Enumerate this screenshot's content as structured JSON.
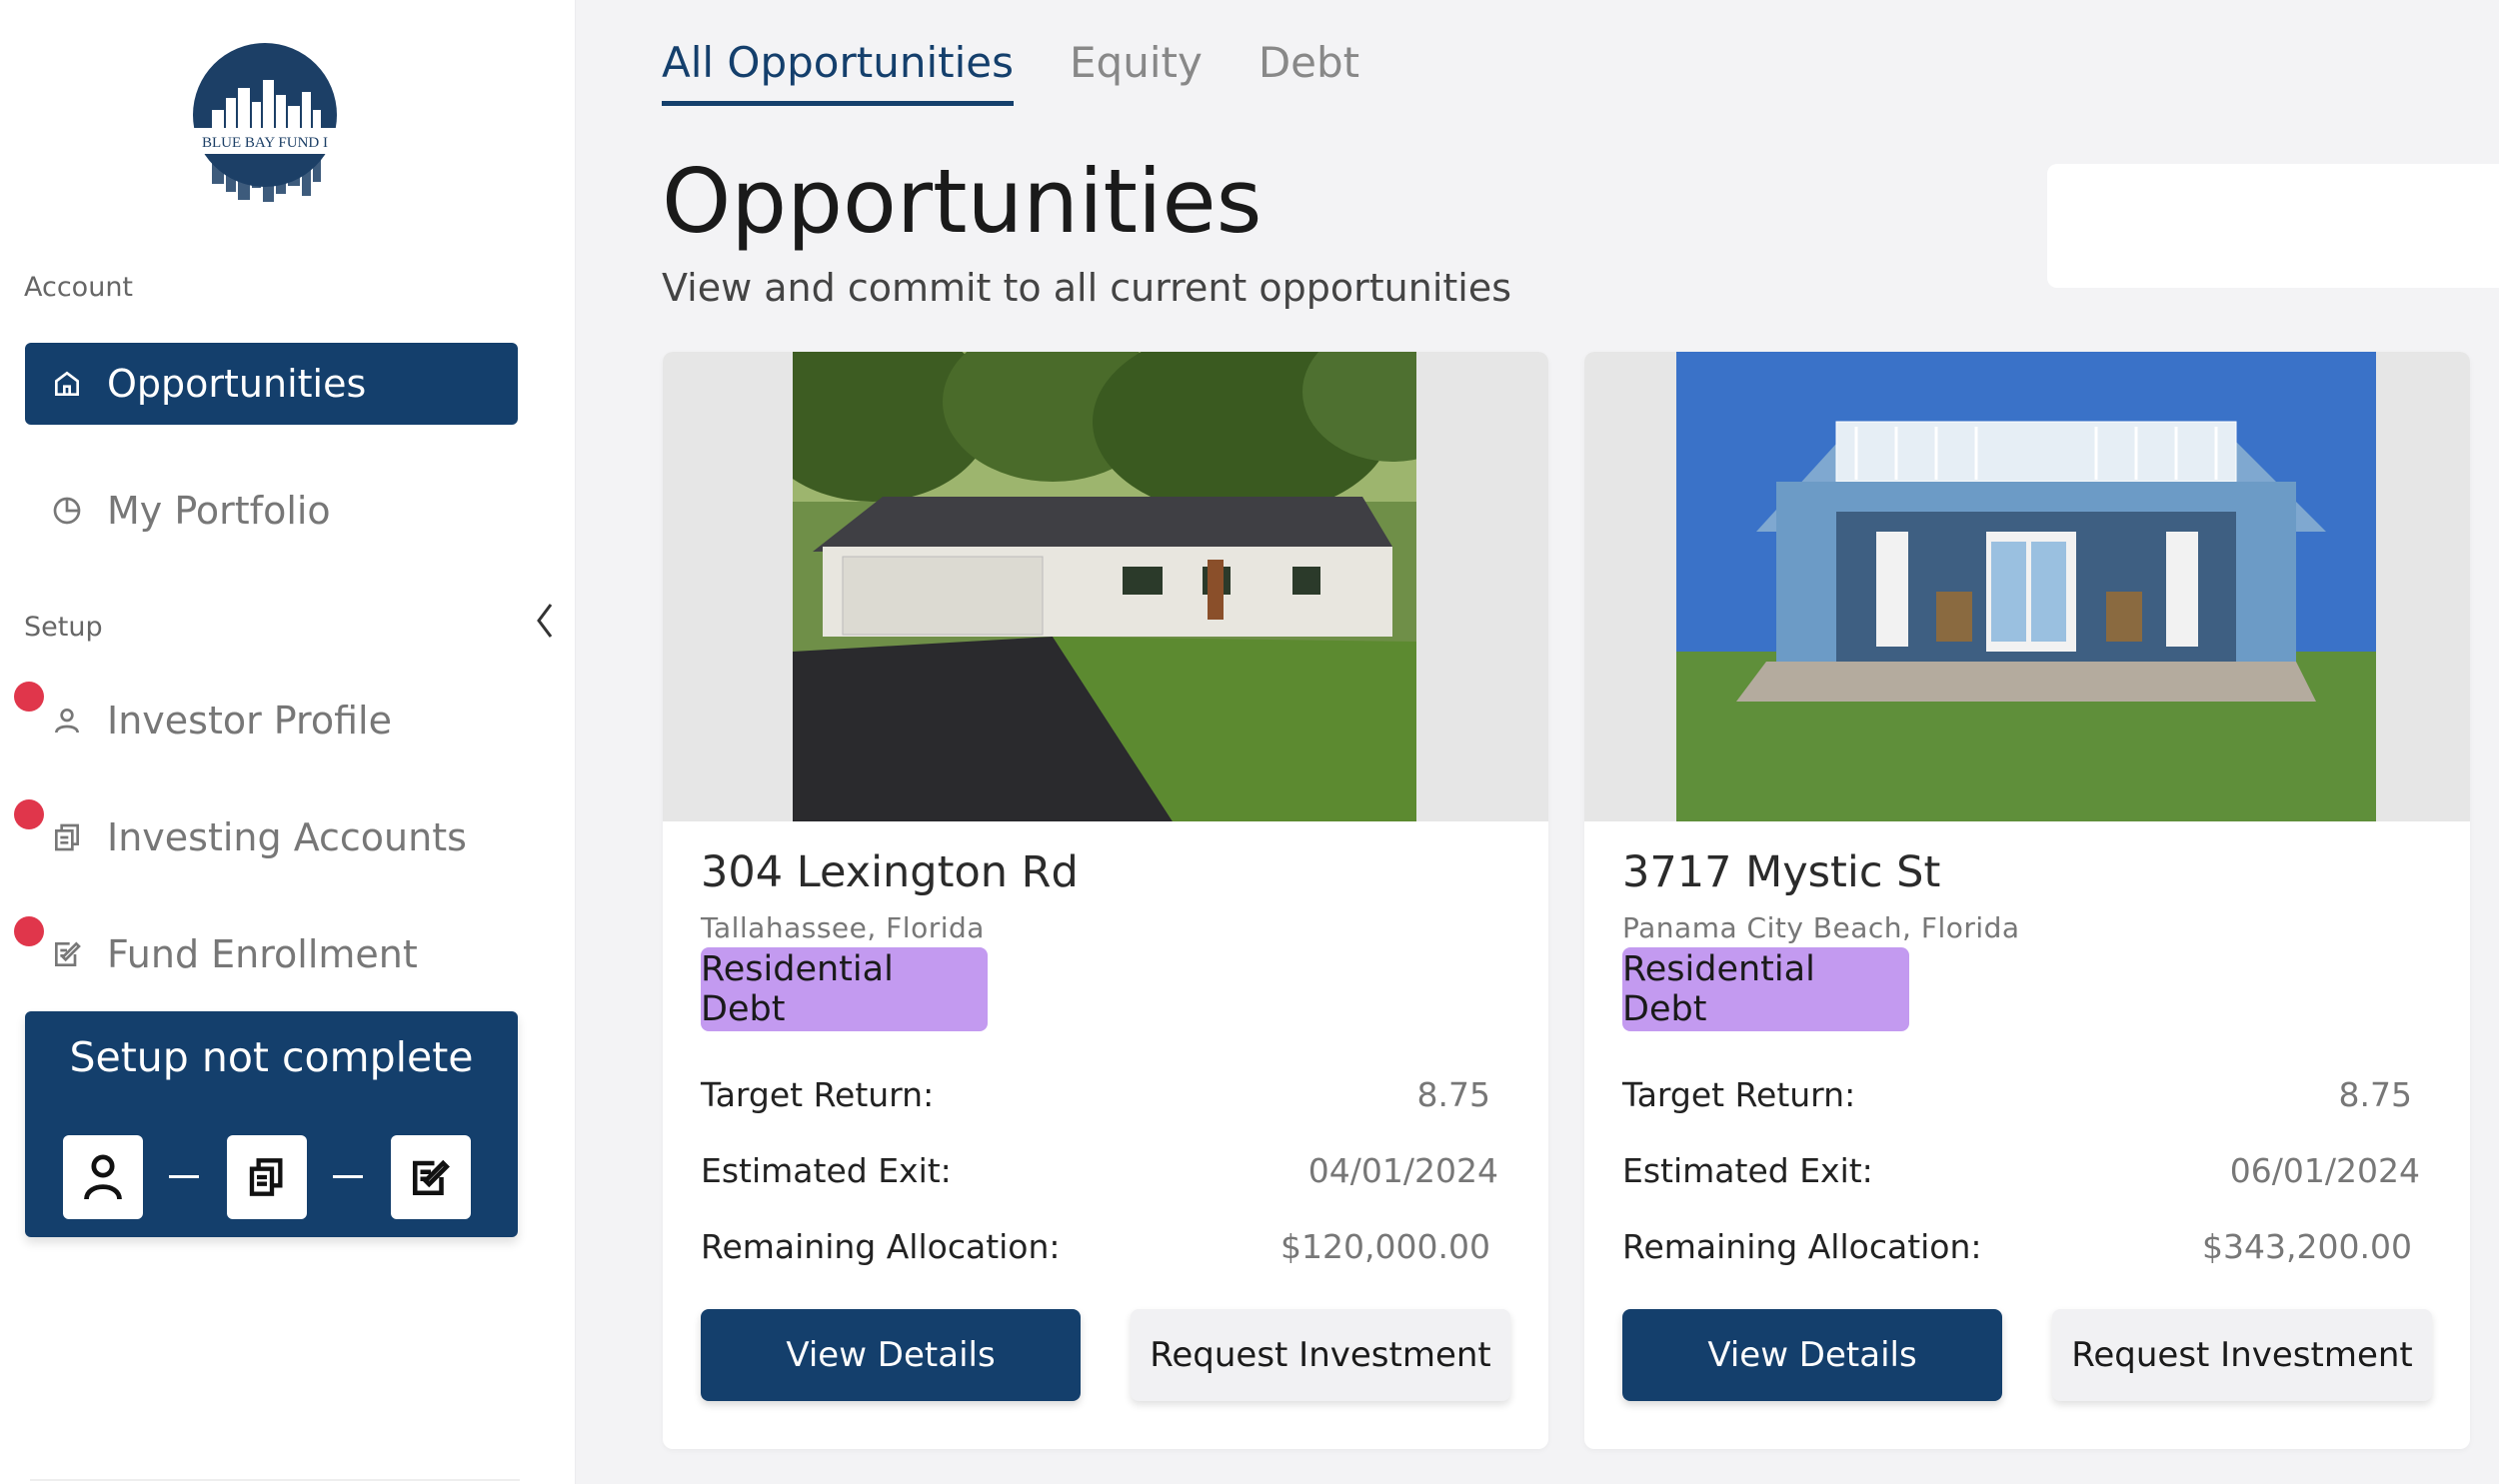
{
  "sidebar": {
    "logo_text": "BLUE BAY FUND I",
    "account_label": "Account",
    "setup_label": "Setup",
    "items": [
      {
        "label": "Opportunities",
        "icon": "home-icon",
        "active": true
      },
      {
        "label": "My Portfolio",
        "icon": "pie-chart-icon",
        "active": false
      },
      {
        "label": "Investor Profile",
        "icon": "user-icon",
        "alert": true
      },
      {
        "label": "Investing Accounts",
        "icon": "copy-icon",
        "alert": true
      },
      {
        "label": "Fund Enrollment",
        "icon": "edit-form-icon",
        "alert": true
      }
    ],
    "setup_box": {
      "title": "Setup not complete",
      "steps": [
        "user-icon",
        "copy-icon",
        "edit-form-icon"
      ]
    },
    "collapse_icon": "chevron-left-icon"
  },
  "tabs": [
    {
      "label": "All Opportunities",
      "active": true
    },
    {
      "label": "Equity",
      "active": false
    },
    {
      "label": "Debt",
      "active": false
    }
  ],
  "page": {
    "title": "Opportunities",
    "subtitle": "View and commit to all current opportunities"
  },
  "cards": [
    {
      "title": "304 Lexington Rd",
      "location": "Tallahassee, Florida",
      "badge": "Residential Debt",
      "target_return_label": "Target Return:",
      "target_return": "8.75",
      "exit_label": "Estimated Exit:",
      "exit": "04/01/2024",
      "allocation_label": "Remaining Allocation:",
      "allocation": "$120,000.00",
      "view_label": "View Details",
      "request_label": "Request Investment"
    },
    {
      "title": "3717 Mystic St",
      "location": "Panama City Beach, Florida",
      "badge": "Residential Debt",
      "target_return_label": "Target Return:",
      "target_return": "8.75",
      "exit_label": "Estimated Exit:",
      "exit": "06/01/2024",
      "allocation_label": "Remaining Allocation:",
      "allocation": "$343,200.00",
      "view_label": "View Details",
      "request_label": "Request Investment"
    }
  ],
  "colors": {
    "brand": "#143f6c",
    "badge": "#c39af0",
    "alert": "#e0364b",
    "background": "#f3f3f5"
  }
}
